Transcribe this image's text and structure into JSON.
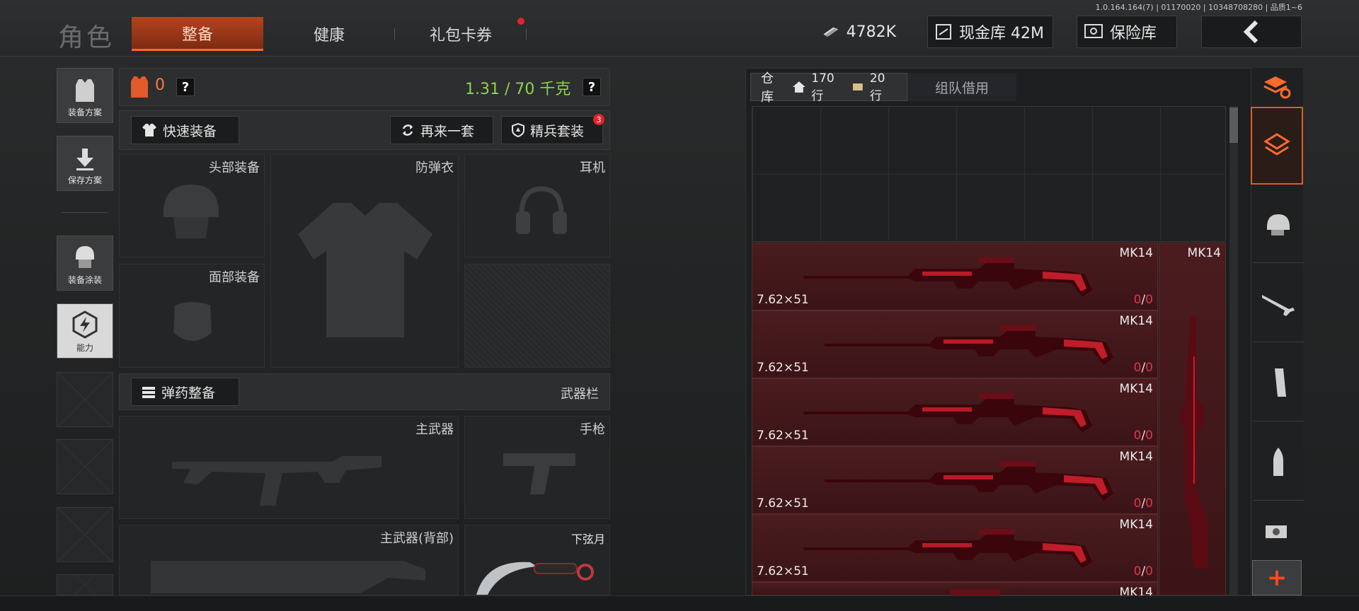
{
  "header": {
    "title": "角色",
    "tabs": [
      {
        "label": "整备",
        "active": true
      },
      {
        "label": "健康",
        "active": false
      },
      {
        "label": "礼包卡券",
        "active": false
      }
    ],
    "currency": "4782K",
    "cash_vault": "现金库 42M",
    "safe": "保险库",
    "version": "1.0.164.164(7) | 01170020 | 10348708280 | 品质1~6"
  },
  "rail": {
    "loadout_plans": "装备方案",
    "save_plan": "保存方案",
    "equipment_skin": "装备涂装",
    "ability": "能力"
  },
  "loadout": {
    "armor_count": "0",
    "help": "?",
    "weight": "1.31 / 70 千克",
    "quick_equip": "快速装备",
    "reroll": "再来一套",
    "elite_set": "精兵套装",
    "elite_badge": "3",
    "slots": {
      "head": "头部装备",
      "vest": "防弹衣",
      "headset": "耳机",
      "face": "面部装备",
      "primary": "主武器",
      "pistol": "手枪",
      "primary_back": "主武器(背部)",
      "melee": "下弦月"
    },
    "ammo_prep": "弹药整备",
    "weapon_bar": "武器栏"
  },
  "storage": {
    "tab_warehouse": "仓库",
    "rows_main": "170行",
    "rows_ext": "20行",
    "tab_team": "组队借用",
    "items": [
      {
        "name": "MK14",
        "caliber": "7.62×51",
        "count_a": "0",
        "sep": "/",
        "count_b": "0"
      },
      {
        "name": "MK14",
        "caliber": "7.62×51",
        "count_a": "0",
        "sep": "/",
        "count_b": "0"
      },
      {
        "name": "MK14",
        "caliber": "7.62×51",
        "count_a": "0",
        "sep": "/",
        "count_b": "0"
      },
      {
        "name": "MK14",
        "caliber": "7.62×51",
        "count_a": "0",
        "sep": "/",
        "count_b": "0"
      },
      {
        "name": "MK14",
        "caliber": "7.62×51",
        "count_a": "0",
        "sep": "/",
        "count_b": "0"
      },
      {
        "name": "MK14"
      }
    ],
    "side_item": "MK14",
    "add": "+"
  },
  "colors": {
    "accent": "#ff6a2d",
    "weight_green": "#8fd14f",
    "count_red": "#e0354a",
    "item_bg": "#4a1c1f"
  }
}
